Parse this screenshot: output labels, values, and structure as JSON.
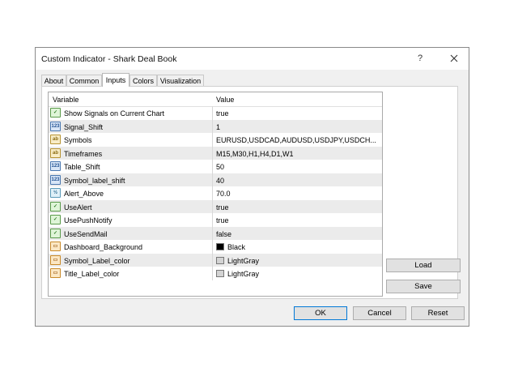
{
  "dialog": {
    "title": "Custom Indicator - Shark Deal Book",
    "help_glyph": "?",
    "close_glyph": "✕"
  },
  "tabs": [
    {
      "label": "About",
      "active": false
    },
    {
      "label": "Common",
      "active": false
    },
    {
      "label": "Inputs",
      "active": true
    },
    {
      "label": "Colors",
      "active": false
    },
    {
      "label": "Visualization",
      "active": false
    }
  ],
  "grid": {
    "headers": {
      "variable": "Variable",
      "value": "Value"
    },
    "rows": [
      {
        "icon": "bool-icon",
        "name": "Show Signals on Current Chart",
        "value": "true"
      },
      {
        "icon": "int-icon",
        "name": "Signal_Shift",
        "value": "1"
      },
      {
        "icon": "string-icon",
        "name": "Symbols",
        "value": "EURUSD,USDCAD,AUDUSD,USDJPY,USDCH..."
      },
      {
        "icon": "string-icon",
        "name": "Timeframes",
        "value": "M15,M30,H1,H4,D1,W1"
      },
      {
        "icon": "int-icon",
        "name": "Table_Shift",
        "value": "50"
      },
      {
        "icon": "int-icon",
        "name": "Symbol_label_shift",
        "value": "40"
      },
      {
        "icon": "double-icon",
        "name": "Alert_Above",
        "value": "70.0"
      },
      {
        "icon": "bool-icon",
        "name": "UseAlert",
        "value": "true"
      },
      {
        "icon": "bool-icon",
        "name": "UsePushNotify",
        "value": "true"
      },
      {
        "icon": "bool-icon",
        "name": "UseSendMail",
        "value": "false"
      },
      {
        "icon": "color-icon",
        "name": "Dashboard_Background",
        "value": "Black",
        "swatch": "#000000"
      },
      {
        "icon": "color-icon",
        "name": "Symbol_Label_color",
        "value": "LightGray",
        "swatch": "#d3d3d3"
      },
      {
        "icon": "color-icon",
        "name": "Title_Label_color",
        "value": "LightGray",
        "swatch": "#d3d3d3"
      }
    ]
  },
  "side_buttons": {
    "load": "Load",
    "save": "Save"
  },
  "footer_buttons": {
    "ok": "OK",
    "cancel": "Cancel",
    "reset": "Reset"
  },
  "icon_glyphs": {
    "bool-icon": "✓",
    "int-icon": "123",
    "string-icon": "ab",
    "double-icon": "½",
    "color-icon": "▭"
  }
}
